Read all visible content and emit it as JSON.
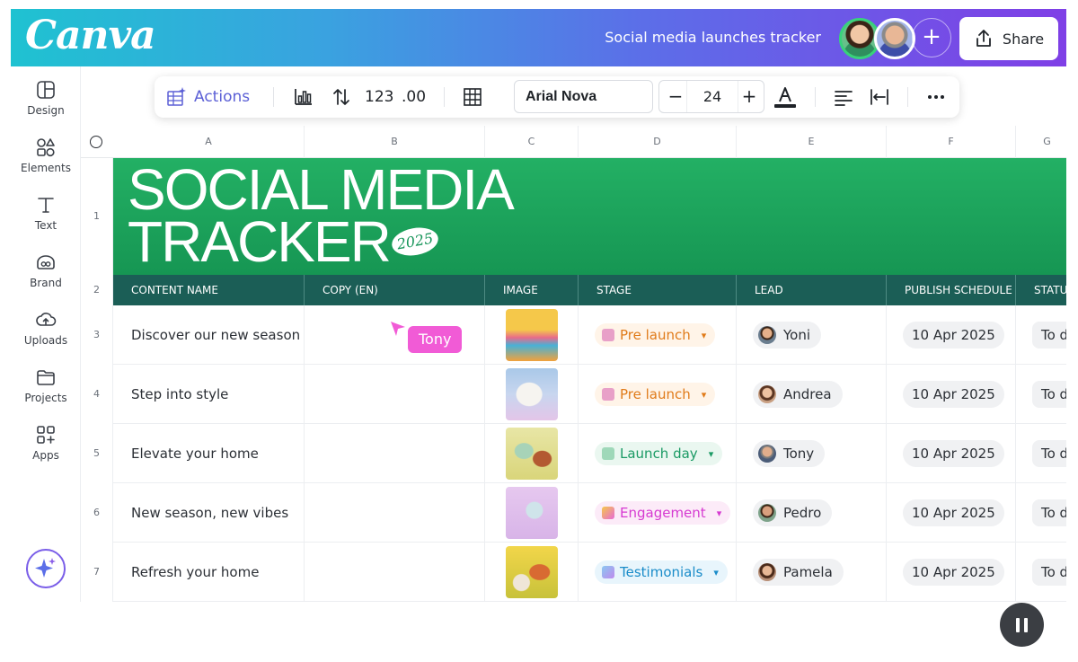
{
  "header": {
    "logo": "Canva",
    "doc_title": "Social media launches tracker",
    "share_label": "Share",
    "add_collaborator_symbol": "+"
  },
  "sidebar": {
    "items": [
      {
        "label": "Design",
        "icon": "layout-icon"
      },
      {
        "label": "Elements",
        "icon": "shapes-icon"
      },
      {
        "label": "Text",
        "icon": "text-icon"
      },
      {
        "label": "Brand",
        "icon": "brand-icon"
      },
      {
        "label": "Uploads",
        "icon": "cloud-upload-icon"
      },
      {
        "label": "Projects",
        "icon": "folder-icon"
      },
      {
        "label": "Apps",
        "icon": "apps-grid-icon"
      }
    ]
  },
  "toolbar": {
    "actions_label": "Actions",
    "number_format": "123",
    "decimal_format": ".00",
    "font_name": "Arial Nova",
    "font_size": "24",
    "minus": "−",
    "plus": "+"
  },
  "grid": {
    "columns": [
      "A",
      "B",
      "C",
      "D",
      "E",
      "F",
      "G"
    ],
    "row_numbers": [
      "1",
      "2",
      "3",
      "4",
      "5",
      "6",
      "7"
    ],
    "banner": {
      "line1": "SOCIAL MEDIA",
      "line2": "TRACKER",
      "year": "2025",
      "color": "#1ea35d"
    },
    "headers": [
      "CONTENT NAME",
      "COPY (EN)",
      "IMAGE",
      "STAGE",
      "LEAD",
      "PUBLISH SCHEDULE",
      "STATUS"
    ],
    "header_color": "#1b5e56",
    "rows": [
      {
        "name": "Discover our new season",
        "stage": "Pre launch",
        "stage_color": "#e07b1a",
        "lead": "Yoni",
        "date": "10 Apr 2025",
        "status": "To do"
      },
      {
        "name": "Step into style",
        "stage": "Pre launch",
        "stage_color": "#e07b1a",
        "lead": "Andrea",
        "date": "10 Apr 2025",
        "status": "To do"
      },
      {
        "name": "Elevate your home",
        "stage": "Launch day",
        "stage_color": "#1a9a64",
        "lead": "Tony",
        "date": "10 Apr 2025",
        "status": "To do"
      },
      {
        "name": "New season, new vibes",
        "stage": "Engagement",
        "stage_color": "#d63ad1",
        "lead": "Pedro",
        "date": "10 Apr 2025",
        "status": "To do"
      },
      {
        "name": "Refresh your home",
        "stage": "Testimonials",
        "stage_color": "#1a8cc9",
        "lead": "Pamela",
        "date": "10 Apr 2025",
        "status": "To do"
      }
    ]
  },
  "collab_cursor": {
    "name": "Tony",
    "color": "#f15bd6"
  },
  "colors": {
    "accent": "#5b5fd6",
    "header_gradient_start": "#1fc2d1",
    "header_gradient_end": "#7f3fe6"
  }
}
